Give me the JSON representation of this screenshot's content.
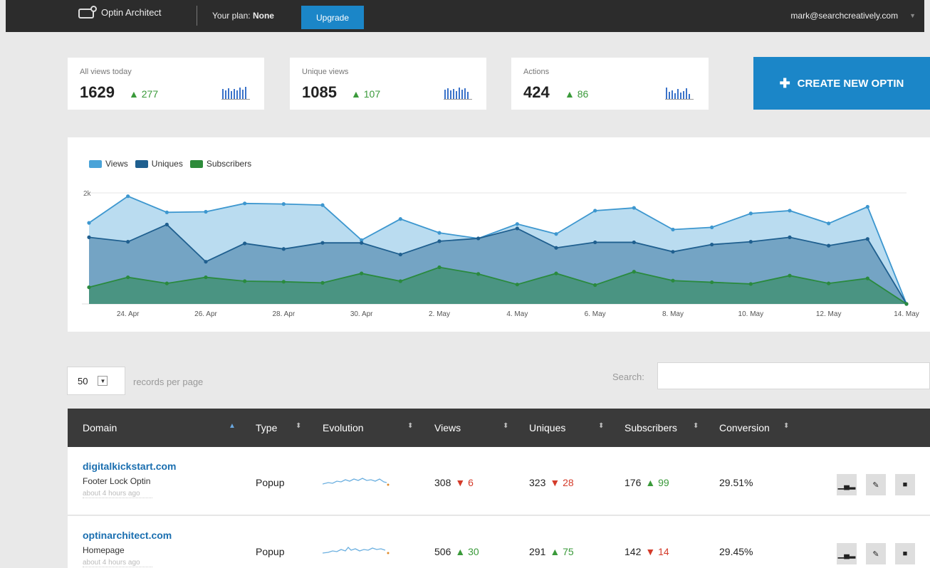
{
  "header": {
    "app_name": "Optin Architect",
    "plan_label": "Your plan:",
    "plan_value": "None",
    "upgrade_label": "Upgrade",
    "account_email": "mark@searchcreatively.com"
  },
  "stats": [
    {
      "label": "All views today",
      "value": "1629",
      "delta": "277",
      "trend": "up"
    },
    {
      "label": "Unique views",
      "value": "1085",
      "delta": "107",
      "trend": "up"
    },
    {
      "label": "Actions",
      "value": "424",
      "delta": "86",
      "trend": "up"
    }
  ],
  "create_button_label": "CREATE NEW OPTIN",
  "chart_data": {
    "type": "area",
    "legend": [
      "Views",
      "Uniques",
      "Subscribers"
    ],
    "y_tick_label": "2k",
    "ylim": [
      0,
      2000
    ],
    "x_tick_labels": [
      "24. Apr",
      "26. Apr",
      "28. Apr",
      "30. Apr",
      "2. May",
      "4. May",
      "6. May",
      "8. May",
      "10. May",
      "12. May",
      "14. May"
    ],
    "x": [
      "23. Apr",
      "24. Apr",
      "25. Apr",
      "26. Apr",
      "27. Apr",
      "28. Apr",
      "29. Apr",
      "30. Apr",
      "1. May",
      "2. May",
      "3. May",
      "4. May",
      "5. May",
      "6. May",
      "7. May",
      "8. May",
      "9. May",
      "10. May",
      "11. May",
      "12. May",
      "13. May",
      "14. May"
    ],
    "series": [
      {
        "name": "Views",
        "color": "#4aa3d8",
        "values": [
          1460,
          1940,
          1650,
          1660,
          1810,
          1800,
          1780,
          1150,
          1530,
          1280,
          1180,
          1440,
          1260,
          1680,
          1730,
          1340,
          1380,
          1630,
          1680,
          1450,
          1750,
          0
        ]
      },
      {
        "name": "Uniques",
        "color": "#2f6f9f",
        "values": [
          1200,
          1120,
          1430,
          760,
          1090,
          990,
          1100,
          1100,
          890,
          1130,
          1180,
          1360,
          1010,
          1110,
          1110,
          940,
          1070,
          1120,
          1200,
          1050,
          1170,
          0
        ]
      },
      {
        "name": "Subscribers",
        "color": "#2e8b57",
        "values": [
          300,
          480,
          370,
          480,
          410,
          400,
          380,
          550,
          410,
          660,
          540,
          350,
          550,
          340,
          580,
          420,
          390,
          360,
          510,
          370,
          460,
          0
        ]
      }
    ],
    "grid": true
  },
  "table_controls": {
    "per_page_value": "50",
    "per_page_label": "records per page",
    "search_label": "Search:"
  },
  "table": {
    "columns": [
      "Domain",
      "Type",
      "Evolution",
      "Views",
      "Uniques",
      "Subscribers",
      "Conversion"
    ],
    "rows": [
      {
        "domain": "digitalkickstart.com",
        "optin": "Footer Lock Optin",
        "time": "about 4 hours ago",
        "type": "Popup",
        "views": "308",
        "views_delta": "6",
        "views_trend": "down",
        "uniques": "323",
        "uniques_delta": "28",
        "uniques_trend": "down",
        "subscribers": "176",
        "subscribers_delta": "99",
        "subscribers_trend": "up",
        "conversion": "29.51%"
      },
      {
        "domain": "optinarchitect.com",
        "optin": "Homepage",
        "time": "about 4 hours ago",
        "type": "Popup",
        "views": "506",
        "views_delta": "30",
        "views_trend": "up",
        "uniques": "291",
        "uniques_delta": "75",
        "uniques_trend": "up",
        "subscribers": "142",
        "subscribers_delta": "14",
        "subscribers_trend": "down",
        "conversion": "29.45%"
      }
    ]
  }
}
